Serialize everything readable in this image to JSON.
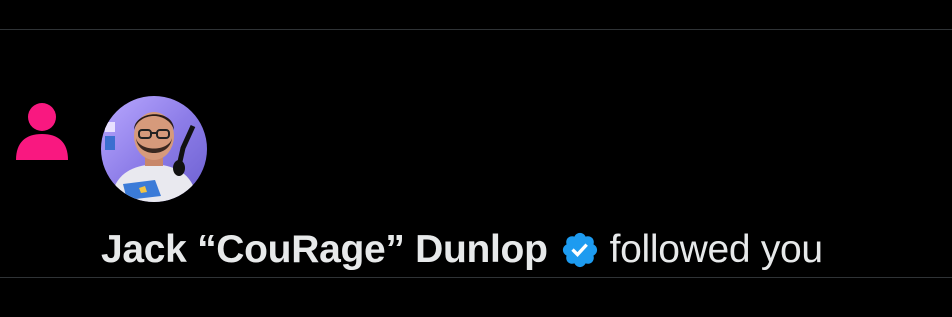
{
  "notification": {
    "type_icon": "person-icon",
    "user": {
      "name": "Jack “CouRage” Dunlop",
      "verified": true,
      "avatar": "avatar-icon"
    },
    "action_text": "followed you"
  },
  "colors": {
    "background": "#000000",
    "divider": "#2f3336",
    "follow_icon": "#f91880",
    "verified_badge": "#1d9bf0",
    "text": "#e7e9ea"
  }
}
